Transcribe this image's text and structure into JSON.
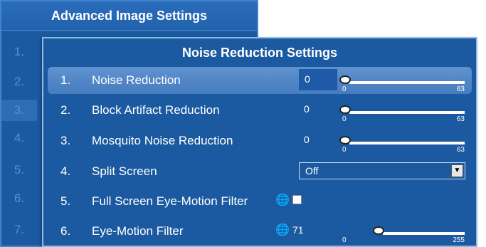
{
  "background_dialog": {
    "title": "Advanced Image Settings",
    "rows": [
      "1.",
      "2.",
      "3.",
      "4.",
      "5.",
      "6.",
      "7."
    ],
    "selected_index": 2
  },
  "dialog": {
    "title": "Noise Reduction Settings",
    "items": [
      {
        "num": "1.",
        "label": "Noise Reduction",
        "value": "0",
        "min": "0",
        "max": "63",
        "fraction": 0.0
      },
      {
        "num": "2.",
        "label": "Block Artifact Reduction",
        "value": "0",
        "min": "0",
        "max": "63",
        "fraction": 0.0
      },
      {
        "num": "3.",
        "label": "Mosquito Noise Reduction",
        "value": "0",
        "min": "0",
        "max": "63",
        "fraction": 0.0
      },
      {
        "num": "4.",
        "label": "Split Screen",
        "dropdown": "Off"
      },
      {
        "num": "5.",
        "label": "Full Screen Eye-Motion Filter",
        "checked": false
      },
      {
        "num": "6.",
        "label": "Eye-Motion Filter",
        "value": "71",
        "min": "0",
        "max": "255",
        "fraction": 0.278
      }
    ]
  },
  "colors": {
    "panel": "#1b5aa0",
    "highlight": "#5f92cf",
    "text": "#ffffff"
  },
  "icons": {
    "globe": "globe-icon",
    "dropdown_arrow": "chevron-down-icon"
  }
}
